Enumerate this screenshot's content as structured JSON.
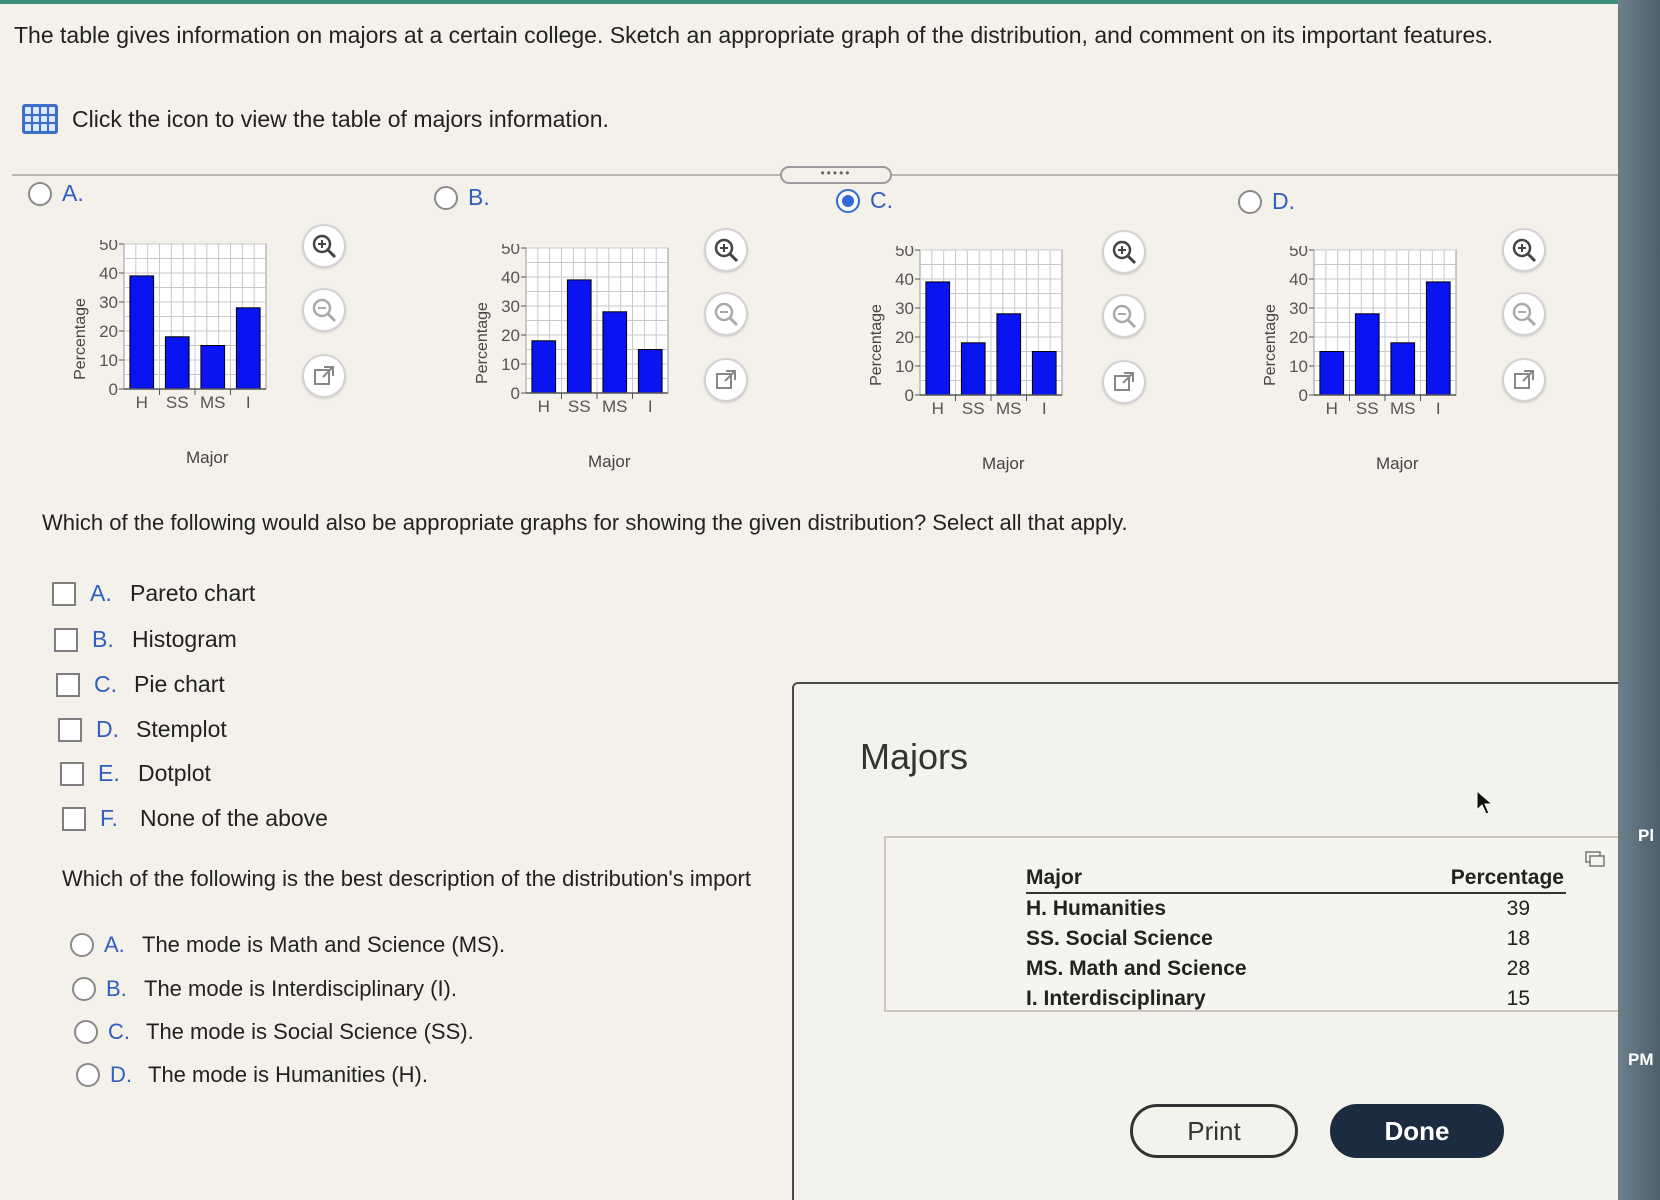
{
  "question1": "The table gives information on majors at a certain college. Sketch an appropriate graph of the distribution, and comment on its important features.",
  "table_link": "Click the icon to view the table of majors information.",
  "graph_options": [
    {
      "letter": "A.",
      "selected": false
    },
    {
      "letter": "B.",
      "selected": false
    },
    {
      "letter": "C.",
      "selected": true
    },
    {
      "letter": "D.",
      "selected": false
    }
  ],
  "chart_data": [
    {
      "type": "bar",
      "categories": [
        "H",
        "SS",
        "MS",
        "I"
      ],
      "values": [
        39,
        18,
        15,
        28
      ],
      "xlabel": "Major",
      "ylabel": "Percentage",
      "ylim": [
        0,
        50
      ],
      "yticks": [
        "0",
        "10",
        "20",
        "30",
        "40",
        "50"
      ],
      "grid": true
    },
    {
      "type": "bar",
      "categories": [
        "H",
        "SS",
        "MS",
        "I"
      ],
      "values": [
        18,
        39,
        28,
        15
      ],
      "xlabel": "Major",
      "ylabel": "Percentage",
      "ylim": [
        0,
        50
      ],
      "yticks": [
        "0",
        "10",
        "20",
        "30",
        "40",
        "50"
      ],
      "grid": true
    },
    {
      "type": "bar",
      "categories": [
        "H",
        "SS",
        "MS",
        "I"
      ],
      "values": [
        39,
        18,
        28,
        15
      ],
      "xlabel": "Major",
      "ylabel": "Percentage",
      "ylim": [
        0,
        50
      ],
      "yticks": [
        "0",
        "10",
        "20",
        "30",
        "40",
        "50"
      ],
      "grid": true
    },
    {
      "type": "bar",
      "categories": [
        "H",
        "SS",
        "MS",
        "I"
      ],
      "values": [
        15,
        28,
        18,
        39
      ],
      "xlabel": "Major",
      "ylabel": "Percentage",
      "ylim": [
        0,
        50
      ],
      "yticks": [
        "0",
        "10",
        "20",
        "30",
        "40",
        "50"
      ],
      "grid": true
    }
  ],
  "question2": "Which of the following would also be appropriate graphs for showing the given distribution? Select all that apply.",
  "checkbox_options": [
    {
      "letter": "A.",
      "label": "Pareto chart"
    },
    {
      "letter": "B.",
      "label": "Histogram"
    },
    {
      "letter": "C.",
      "label": "Pie chart"
    },
    {
      "letter": "D.",
      "label": "Stemplot"
    },
    {
      "letter": "E.",
      "label": "Dotplot"
    },
    {
      "letter": "F.",
      "label": "None of the above"
    }
  ],
  "question3": "Which of the following is the best description of the distribution's import",
  "mode_options": [
    {
      "letter": "A.",
      "label": "The mode is Math and Science (MS)."
    },
    {
      "letter": "B.",
      "label": "The mode is Interdisciplinary (I)."
    },
    {
      "letter": "C.",
      "label": "The mode is Social Science (SS)."
    },
    {
      "letter": "D.",
      "label": "The mode is Humanities (H)."
    }
  ],
  "modal": {
    "title": "Majors",
    "headers": {
      "major": "Major",
      "pct": "Percentage"
    },
    "rows": [
      {
        "major": "H. Humanities",
        "pct": "39"
      },
      {
        "major": "SS. Social Science",
        "pct": "18"
      },
      {
        "major": "MS. Math and Science",
        "pct": "28"
      },
      {
        "major": "I. Interdisciplinary",
        "pct": "15"
      }
    ],
    "print_label": "Print",
    "done_label": "Done"
  },
  "edge_text": {
    "pl": "Pl",
    "pm": "PM"
  },
  "colors": {
    "bar": "#0a14f0",
    "accent": "#2f5fbf",
    "done_bg": "#1c2b3f"
  }
}
